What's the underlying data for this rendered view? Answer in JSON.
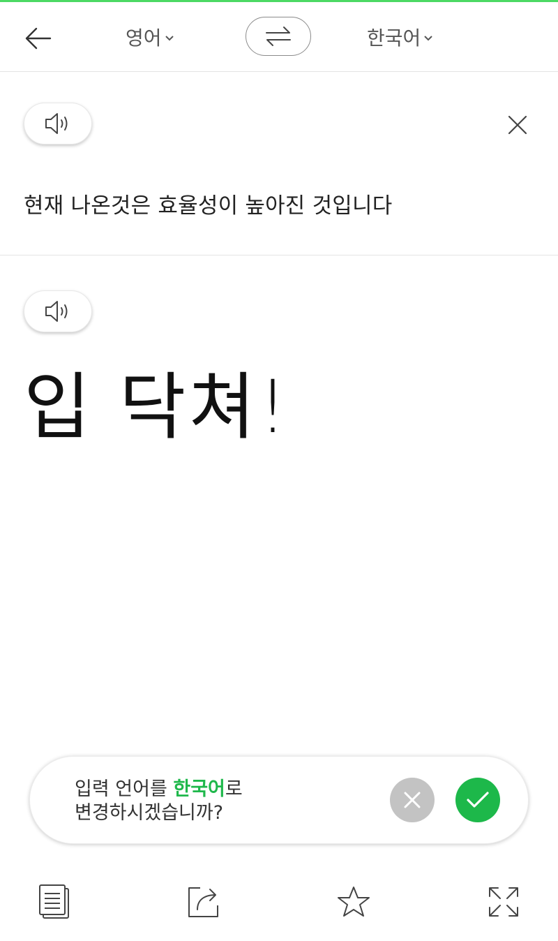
{
  "header": {
    "source_lang": "영어",
    "target_lang": "한국어",
    "back_icon": "arrow-left-icon",
    "swap_icon": "swap-arrows-icon"
  },
  "source": {
    "text": "현재 나온것은 효율성이 높아진 것입니다",
    "speak_icon": "speaker-icon",
    "clear_icon": "close-icon"
  },
  "result": {
    "text": "입 닥쳐!",
    "speak_icon": "speaker-icon"
  },
  "suggestion": {
    "prefix": "입력 언어를 ",
    "language": "한국어",
    "suffix_line1": "로",
    "line2": "변경하시겠습니까?",
    "reject_icon": "close-icon",
    "accept_icon": "check-icon"
  },
  "bottom_bar": {
    "items": [
      {
        "icon": "copy-icon"
      },
      {
        "icon": "share-icon"
      },
      {
        "icon": "star-icon"
      },
      {
        "icon": "fullscreen-icon"
      }
    ]
  },
  "colors": {
    "accent": "#1db84a",
    "accent_text": "#1fb84b",
    "top_bar": "#4cd964",
    "reject": "#c3c3c3"
  }
}
